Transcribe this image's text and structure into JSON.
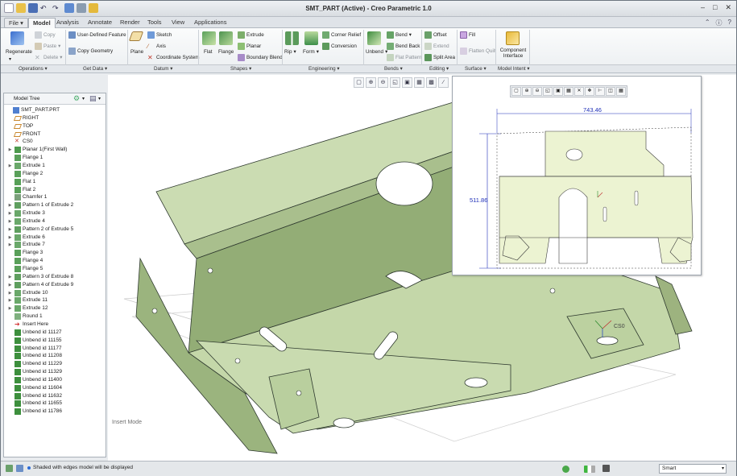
{
  "window": {
    "title": "SMT_PART (Active) - Creo Parametric 1.0"
  },
  "tabs": [
    "File",
    "Model",
    "Analysis",
    "Annotate",
    "Render",
    "Tools",
    "View",
    "Applications"
  ],
  "ribbon": {
    "regenerate": "Regenerate",
    "copy": "Copy",
    "paste": "Paste",
    "delete": "Delete",
    "udf": "User-Defined Feature",
    "copy_geometry": "Copy Geometry",
    "plane": "Plane",
    "sketch": "Sketch",
    "axis": "Axis",
    "coordinate_system": "Coordinate System",
    "flat": "Flat",
    "flange": "Flange",
    "extrude": "Extrude",
    "planar": "Planar",
    "boundary_blend": "Boundary Blend",
    "rip": "Rip",
    "form": "Form",
    "corner_relief": "Corner Relief",
    "conversion": "Conversion",
    "unbend": "Unbend",
    "bend": "Bend",
    "bend_back": "Bend Back",
    "flat_pattern": "Flat Pattern",
    "offset": "Offset",
    "extend": "Extend",
    "split_area": "Split Area",
    "fill": "Fill",
    "flatten_quilt": "Flatten Quilt",
    "component_interface": "Component Interface"
  },
  "groups": [
    "Operations",
    "Get Data",
    "Datum",
    "Shapes",
    "Engineering",
    "Bends",
    "Editing",
    "Surface",
    "Model Intent"
  ],
  "model_tree": {
    "title": "Model Tree",
    "items": [
      {
        "label": "SMT_PART.PRT",
        "icon": "part-icon",
        "expand": false,
        "indent": 0
      },
      {
        "label": "RIGHT",
        "icon": "datum-plane-icon",
        "expand": false,
        "indent": 1
      },
      {
        "label": "TOP",
        "icon": "datum-plane-icon",
        "expand": false,
        "indent": 1
      },
      {
        "label": "FRONT",
        "icon": "datum-plane-icon",
        "expand": false,
        "indent": 1
      },
      {
        "label": "CS0",
        "icon": "csys-icon",
        "expand": false,
        "indent": 1
      },
      {
        "label": "Planar 1(First Wall)",
        "icon": "wall-icon",
        "expand": true,
        "indent": 1
      },
      {
        "label": "Flange 1",
        "icon": "flange-icon",
        "expand": false,
        "indent": 1
      },
      {
        "label": "Extrude 1",
        "icon": "extrude-icon",
        "expand": true,
        "indent": 1
      },
      {
        "label": "Flange 2",
        "icon": "flange-icon",
        "expand": false,
        "indent": 1
      },
      {
        "label": "Flat 1",
        "icon": "flat-icon",
        "expand": false,
        "indent": 1
      },
      {
        "label": "Flat 2",
        "icon": "flat-icon",
        "expand": false,
        "indent": 1
      },
      {
        "label": "Chamfer 1",
        "icon": "chamfer-icon",
        "expand": false,
        "indent": 1
      },
      {
        "label": "Pattern 1 of Extrude 2",
        "icon": "pattern-icon",
        "expand": true,
        "indent": 1
      },
      {
        "label": "Extrude 3",
        "icon": "extrude-icon",
        "expand": true,
        "indent": 1
      },
      {
        "label": "Extrude 4",
        "icon": "extrude-icon",
        "expand": true,
        "indent": 1
      },
      {
        "label": "Pattern 2 of Extrude 5",
        "icon": "pattern-icon",
        "expand": true,
        "indent": 1
      },
      {
        "label": "Extrude 6",
        "icon": "extrude-icon",
        "expand": true,
        "indent": 1
      },
      {
        "label": "Extrude 7",
        "icon": "extrude-icon",
        "expand": true,
        "indent": 1
      },
      {
        "label": "Flange 3",
        "icon": "flange-icon",
        "expand": false,
        "indent": 1
      },
      {
        "label": "Flange 4",
        "icon": "flange-icon",
        "expand": false,
        "indent": 1
      },
      {
        "label": "Flange 5",
        "icon": "flange-icon",
        "expand": false,
        "indent": 1
      },
      {
        "label": "Pattern 3 of Extrude 8",
        "icon": "pattern-icon",
        "expand": true,
        "indent": 1
      },
      {
        "label": "Pattern 4 of Extrude 9",
        "icon": "pattern-icon",
        "expand": true,
        "indent": 1
      },
      {
        "label": "Extrude 10",
        "icon": "extrude-icon",
        "expand": true,
        "indent": 1
      },
      {
        "label": "Extrude 11",
        "icon": "extrude-icon",
        "expand": true,
        "indent": 1
      },
      {
        "label": "Extrude 12",
        "icon": "extrude-icon",
        "expand": true,
        "indent": 1
      },
      {
        "label": "Round 1",
        "icon": "round-icon",
        "expand": false,
        "indent": 1
      },
      {
        "label": "Insert Here",
        "icon": "insert-arrow-icon",
        "expand": false,
        "indent": 1
      },
      {
        "label": "Unbend id 11127",
        "icon": "unbend-icon",
        "expand": false,
        "indent": 1
      },
      {
        "label": "Unbend id 11155",
        "icon": "unbend-icon",
        "expand": false,
        "indent": 1
      },
      {
        "label": "Unbend id 11177",
        "icon": "unbend-icon",
        "expand": false,
        "indent": 1
      },
      {
        "label": "Unbend id 11208",
        "icon": "unbend-icon",
        "expand": false,
        "indent": 1
      },
      {
        "label": "Unbend id 11229",
        "icon": "unbend-icon",
        "expand": false,
        "indent": 1
      },
      {
        "label": "Unbend id 11329",
        "icon": "unbend-icon",
        "expand": false,
        "indent": 1
      },
      {
        "label": "Unbend id 11400",
        "icon": "unbend-icon",
        "expand": false,
        "indent": 1
      },
      {
        "label": "Unbend id 11604",
        "icon": "unbend-icon",
        "expand": false,
        "indent": 1
      },
      {
        "label": "Unbend id 11632",
        "icon": "unbend-icon",
        "expand": false,
        "indent": 1
      },
      {
        "label": "Unbend id 11655",
        "icon": "unbend-icon",
        "expand": false,
        "indent": 1
      },
      {
        "label": "Unbend id 11786",
        "icon": "unbend-icon",
        "expand": false,
        "indent": 1
      }
    ]
  },
  "viewport": {
    "mode_label": "Insert Mode",
    "csys_label": "CS0",
    "part_color": "#c7d8ad"
  },
  "flat_preview": {
    "dim_width": "743.46",
    "dim_height": "511.86",
    "flat_color": "#ecf3d2"
  },
  "status": {
    "message": "Shaded with edges model will be displayed",
    "filter": "Smart"
  }
}
